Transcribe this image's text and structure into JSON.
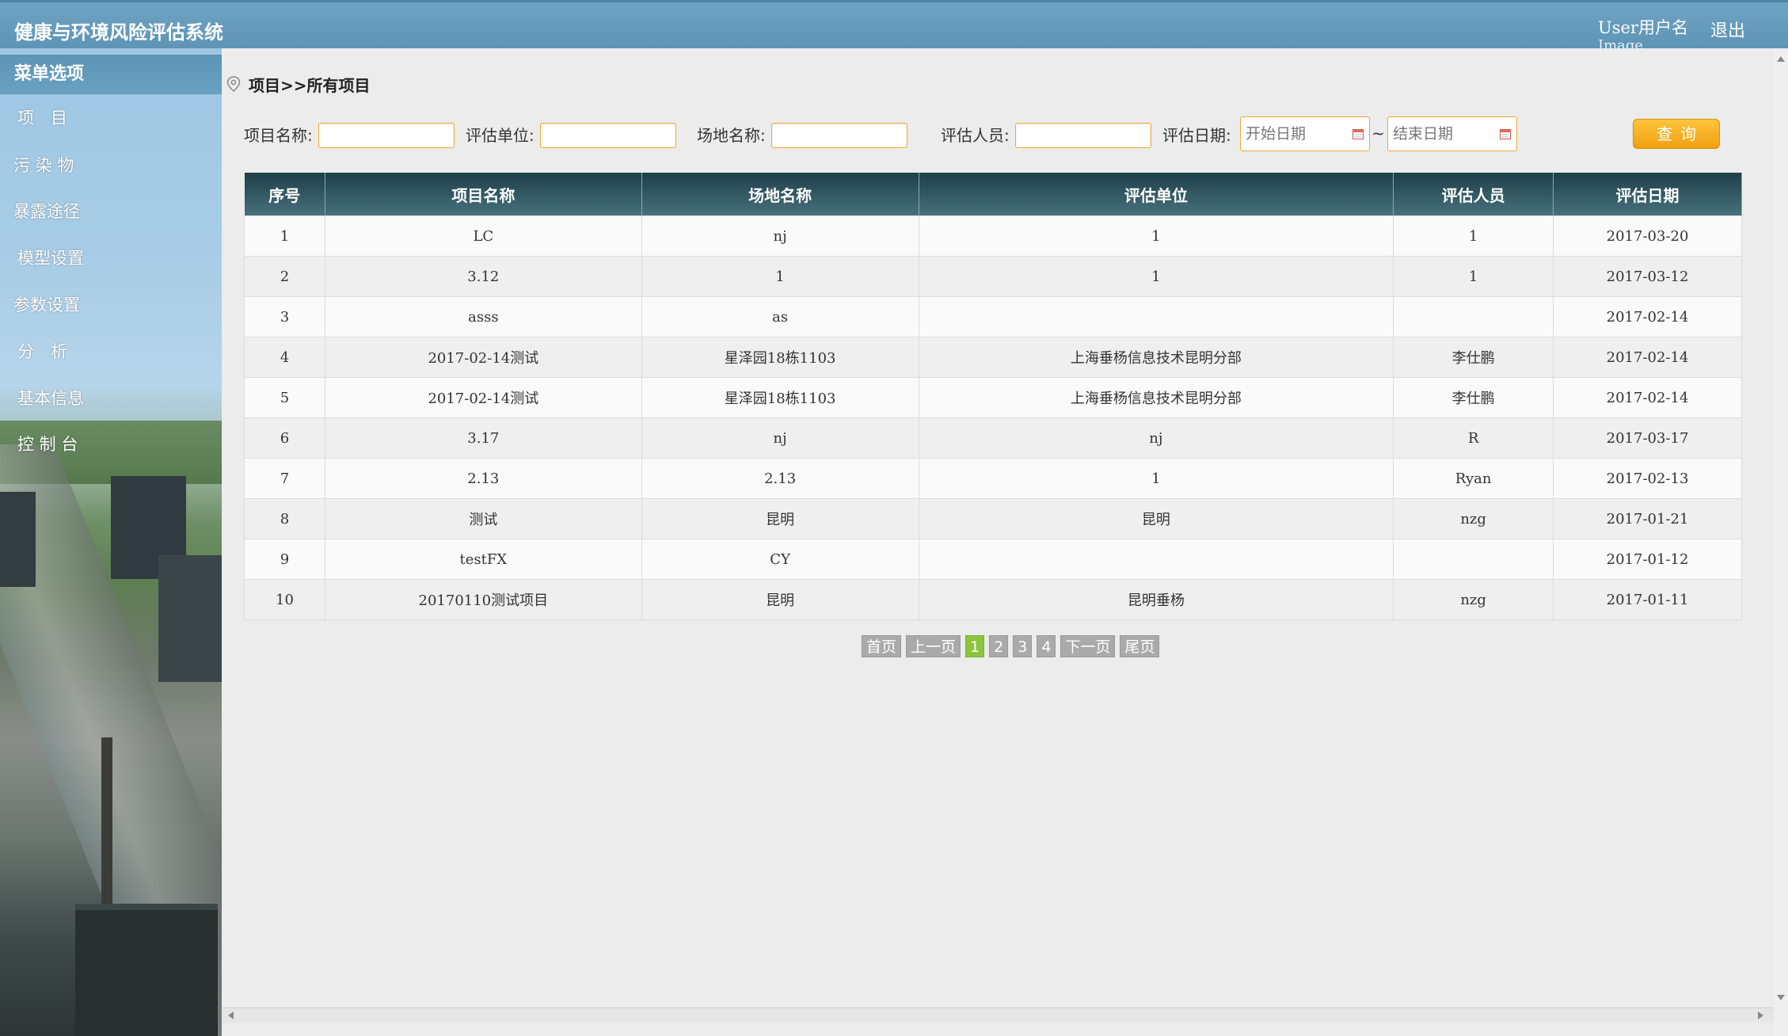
{
  "header": {
    "app_title": "健康与环境风险评估系统",
    "user_label": "User用户名",
    "user_sub": "Image",
    "logout_label": "退出"
  },
  "sidebar": {
    "menu_header": "菜单选项",
    "items": [
      {
        "label": "项　目"
      },
      {
        "label": "污 染 物"
      },
      {
        "label": "暴露途径"
      },
      {
        "label": "模型设置"
      },
      {
        "label": "参数设置"
      },
      {
        "label": "分　析"
      },
      {
        "label": "基本信息"
      },
      {
        "label": "控 制 台"
      }
    ]
  },
  "breadcrumb": {
    "text": "项目>>所有项目"
  },
  "filters": {
    "project_name_label": "项目名称:",
    "eval_unit_label": "评估单位:",
    "site_name_label": "场地名称:",
    "evaluator_label": "评估人员:",
    "eval_date_label": "评估日期:",
    "start_date_placeholder": "开始日期",
    "end_date_placeholder": "结束日期",
    "date_separator": "~",
    "query_label": "查询"
  },
  "table": {
    "headers": [
      "序号",
      "项目名称",
      "场地名称",
      "评估单位",
      "评估人员",
      "评估日期"
    ],
    "rows": [
      [
        "1",
        "LC",
        "nj",
        "1",
        "1",
        "2017-03-20"
      ],
      [
        "2",
        "3.12",
        "1",
        "1",
        "1",
        "2017-03-12"
      ],
      [
        "3",
        "asss",
        "as",
        "",
        "",
        "2017-02-14"
      ],
      [
        "4",
        "2017-02-14测试",
        "星泽园18栋1103",
        "上海垂杨信息技术昆明分部",
        "李仕鹏",
        "2017-02-14"
      ],
      [
        "5",
        "2017-02-14测试",
        "星泽园18栋1103",
        "上海垂杨信息技术昆明分部",
        "李仕鹏",
        "2017-02-14"
      ],
      [
        "6",
        "3.17",
        "nj",
        "nj",
        "R",
        "2017-03-17"
      ],
      [
        "7",
        "2.13",
        "2.13",
        "1",
        "Ryan",
        "2017-02-13"
      ],
      [
        "8",
        "测试",
        "昆明",
        "昆明",
        "nzg",
        "2017-01-21"
      ],
      [
        "9",
        "testFX",
        "CY",
        "",
        "",
        "2017-01-12"
      ],
      [
        "10",
        "20170110测试项目",
        "昆明",
        "昆明垂杨",
        "nzg",
        "2017-01-11"
      ]
    ]
  },
  "pagination": {
    "first": "首页",
    "prev": "上一页",
    "pages": [
      "1",
      "2",
      "3",
      "4"
    ],
    "current": "1",
    "next": "下一页",
    "last": "尾页"
  },
  "colors": {
    "header_bg": "#6199bb",
    "table_header_bg": "#2b5460",
    "input_border": "#f0a830",
    "query_button": "#f5ad1f",
    "active_page": "#8cc43e"
  }
}
